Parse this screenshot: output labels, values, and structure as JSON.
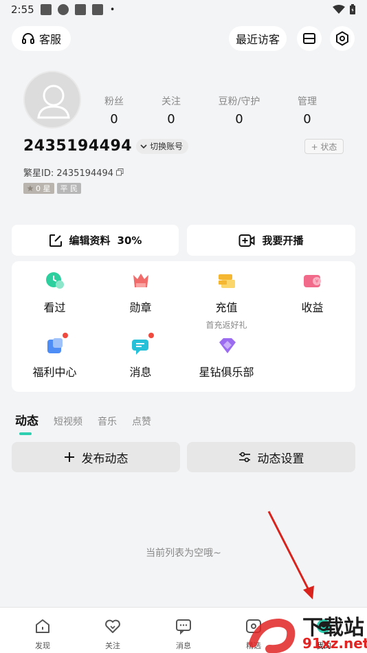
{
  "status_bar": {
    "time": "2:55",
    "dot": "•"
  },
  "header": {
    "service_label": "客服",
    "visitors_label": "最近访客"
  },
  "profile": {
    "stats": [
      {
        "label": "粉丝",
        "value": "0"
      },
      {
        "label": "关注",
        "value": "0"
      },
      {
        "label": "豆粉/守护",
        "value": "0"
      },
      {
        "label": "管理",
        "value": "0"
      }
    ],
    "uid": "2435194494",
    "switch_account": "切换账号",
    "status_tag": "+ 状态",
    "star_id": "繁星ID: 2435194494",
    "star_badge": "0 星",
    "rank_badge": "平 民"
  },
  "actions": {
    "edit_profile": "编辑资料",
    "edit_percent": "30%",
    "go_live": "我要开播"
  },
  "grid": [
    {
      "label": "看过",
      "sub": "",
      "color": "#2ecf9e"
    },
    {
      "label": "勋章",
      "sub": "",
      "color": "#f26b6b"
    },
    {
      "label": "充值",
      "sub": "首充返好礼",
      "color": "#f5b731"
    },
    {
      "label": "收益",
      "sub": "",
      "color": "#f26a8a"
    },
    {
      "label": "福利中心",
      "sub": "",
      "color": "#4d8df5"
    },
    {
      "label": "消息",
      "sub": "",
      "color": "#26c1d9"
    },
    {
      "label": "星钻俱乐部",
      "sub": "",
      "color": "#9c6cf0"
    }
  ],
  "tabs": [
    "动态",
    "短视频",
    "音乐",
    "点赞"
  ],
  "feed": {
    "publish": "发布动态",
    "settings": "动态设置",
    "empty": "当前列表为空哦~"
  },
  "bottom_nav": [
    "发现",
    "关注",
    "消息",
    "精选",
    "我的"
  ],
  "watermark": {
    "brand": "下载站",
    "domain": "91xz.net"
  }
}
